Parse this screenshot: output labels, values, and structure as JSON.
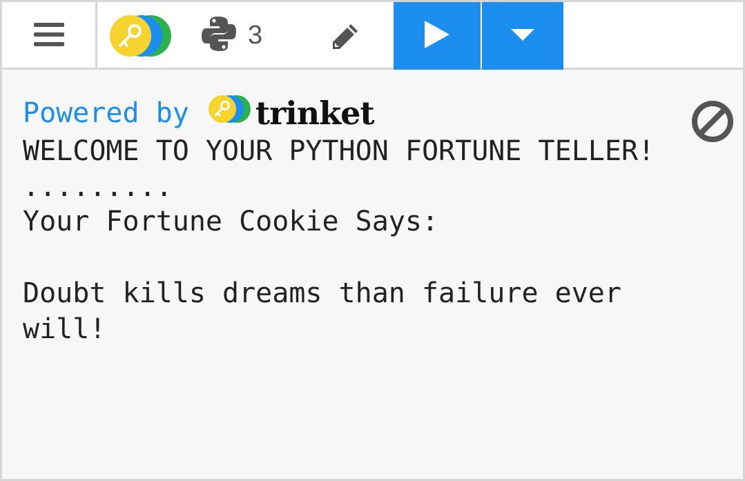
{
  "toolbar": {
    "menu_icon": "hamburger-menu-icon",
    "logo_icon": "trinket-key-logo-icon",
    "language_icon": "python-logo-icon",
    "language_count": "3",
    "edit_icon": "pencil-icon",
    "run_icon": "play-icon",
    "run_menu_icon": "caret-down-icon",
    "colors": {
      "accent": "#1c8ef0",
      "icon_gray": "#555555",
      "border": "#d6d6d6",
      "logo_yellow": "#f6d32d",
      "logo_blue": "#1c8ef0",
      "logo_green": "#2bb24c"
    }
  },
  "output": {
    "powered_by": "Powered by",
    "brand_name": "trinket",
    "clear_icon": "clear-output-icon",
    "lines": [
      "WELCOME TO YOUR PYTHON FORTUNE TELLER!",
      ".........",
      "Your Fortune Cookie Says:",
      "",
      "Doubt kills dreams than failure ever",
      "will!"
    ]
  }
}
